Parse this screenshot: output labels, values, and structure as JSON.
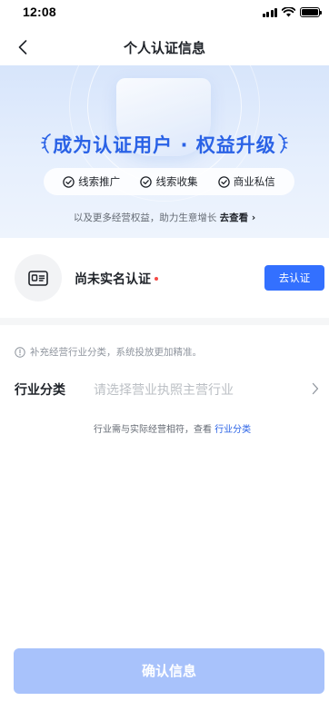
{
  "status_bar": {
    "time": "12:08"
  },
  "nav": {
    "title": "个人认证信息"
  },
  "banner": {
    "title": "成为认证用户 · 权益升级",
    "features": [
      "线索推广",
      "线索收集",
      "商业私信"
    ],
    "subtitle": "以及更多经营权益，助力生意增长",
    "see_more": "去查看 ›"
  },
  "verify": {
    "status_label": "尚未实名认证",
    "button_label": "去认证"
  },
  "industry": {
    "hint": "补充经营行业分类，系统投放更加精准。",
    "label": "行业分类",
    "placeholder": "请选择营业执照主营行业",
    "note_prefix": "行业需与实际经营相符，查看",
    "note_link": "行业分类"
  },
  "footer": {
    "confirm_label": "确认信息"
  },
  "colors": {
    "accent": "#3370ff",
    "title_blue": "#2a62e6",
    "disabled_button": "#a8c2fb",
    "required_dot": "#f54a45"
  }
}
